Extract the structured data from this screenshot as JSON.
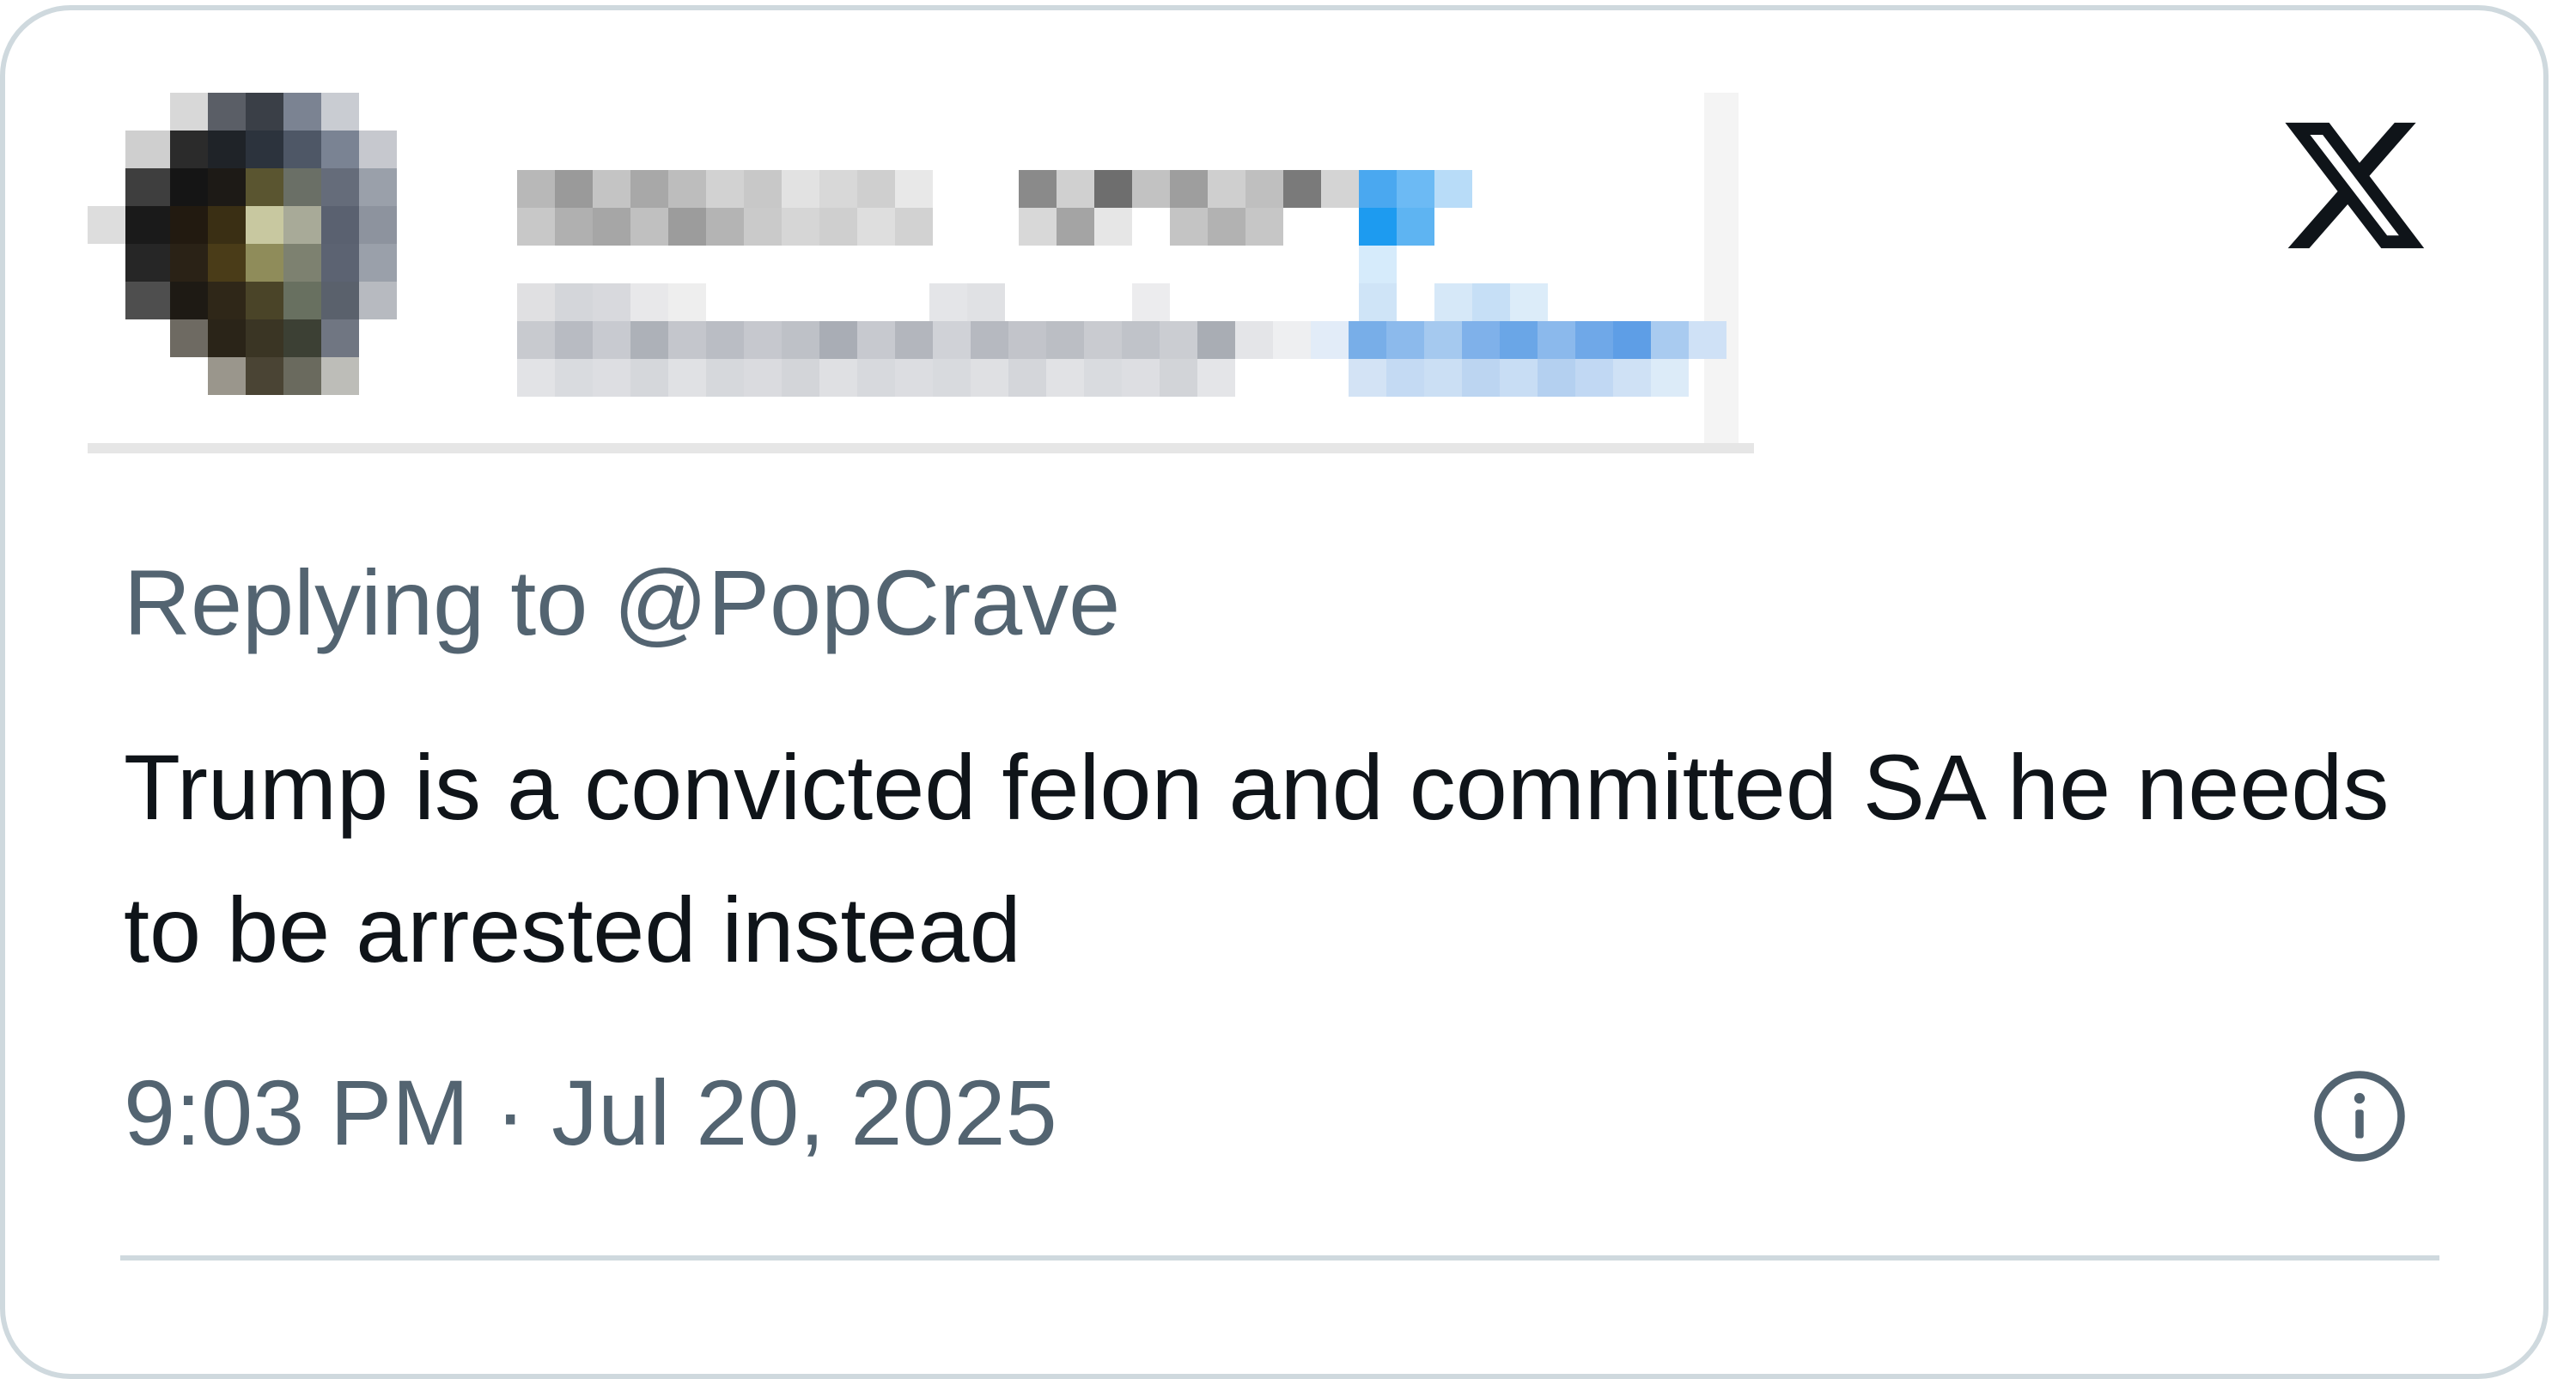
{
  "tweet": {
    "author_redacted": true,
    "reply_prefix": "Replying to",
    "reply_handle": "@PopCrave",
    "text": "Trump is a convicted felon and committed SA he needs to be arrested instead",
    "timestamp": "9:03 PM · Jul 20, 2025"
  },
  "icons": {
    "brand": "x-logo-icon",
    "info": "info-icon"
  },
  "colors": {
    "secondary_text": "#536471",
    "primary_text": "#0f1419",
    "border": "#cfd9de",
    "verified_blue": "#1d9bf0"
  }
}
